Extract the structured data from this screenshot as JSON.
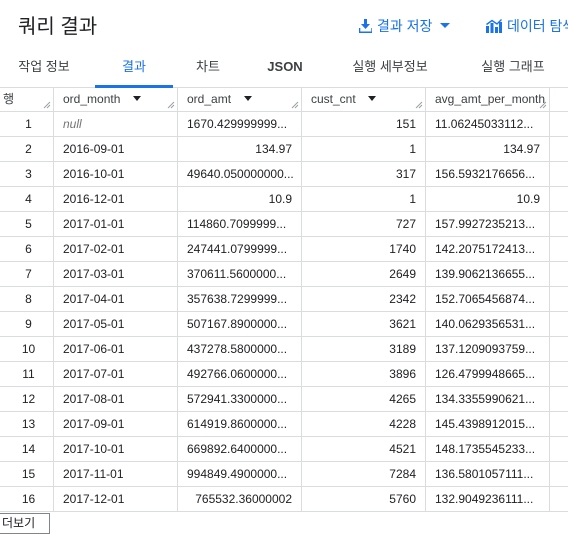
{
  "header": {
    "title": "쿼리 결과",
    "save_label": "결과 저장",
    "explore_label": "데이터 탐색"
  },
  "tabs": [
    {
      "label": "작업 정보"
    },
    {
      "label": "결과"
    },
    {
      "label": "차트"
    },
    {
      "label": "JSON"
    },
    {
      "label": "실행 세부정보"
    },
    {
      "label": "실행 그래프"
    }
  ],
  "table": {
    "columns": [
      "행",
      "ord_month",
      "ord_amt",
      "cust_cnt",
      "avg_amt_per_month"
    ],
    "rows": [
      {
        "idx": "1",
        "ord_month": "null",
        "ord_amt": "1670.429999999...",
        "cust_cnt": "151",
        "avg": "11.06245033112..."
      },
      {
        "idx": "2",
        "ord_month": "2016-09-01",
        "ord_amt": "134.97",
        "cust_cnt": "1",
        "avg": "134.97"
      },
      {
        "idx": "3",
        "ord_month": "2016-10-01",
        "ord_amt": "49640.050000000...",
        "cust_cnt": "317",
        "avg": "156.5932176656..."
      },
      {
        "idx": "4",
        "ord_month": "2016-12-01",
        "ord_amt": "10.9",
        "cust_cnt": "1",
        "avg": "10.9"
      },
      {
        "idx": "5",
        "ord_month": "2017-01-01",
        "ord_amt": "114860.7099999...",
        "cust_cnt": "727",
        "avg": "157.9927235213..."
      },
      {
        "idx": "6",
        "ord_month": "2017-02-01",
        "ord_amt": "247441.0799999...",
        "cust_cnt": "1740",
        "avg": "142.2075172413..."
      },
      {
        "idx": "7",
        "ord_month": "2017-03-01",
        "ord_amt": "370611.5600000...",
        "cust_cnt": "2649",
        "avg": "139.9062136655..."
      },
      {
        "idx": "8",
        "ord_month": "2017-04-01",
        "ord_amt": "357638.7299999...",
        "cust_cnt": "2342",
        "avg": "152.7065456874..."
      },
      {
        "idx": "9",
        "ord_month": "2017-05-01",
        "ord_amt": "507167.8900000...",
        "cust_cnt": "3621",
        "avg": "140.0629356531..."
      },
      {
        "idx": "10",
        "ord_month": "2017-06-01",
        "ord_amt": "437278.5800000...",
        "cust_cnt": "3189",
        "avg": "137.1209093759..."
      },
      {
        "idx": "11",
        "ord_month": "2017-07-01",
        "ord_amt": "492766.0600000...",
        "cust_cnt": "3896",
        "avg": "126.4799948665..."
      },
      {
        "idx": "12",
        "ord_month": "2017-08-01",
        "ord_amt": "572941.3300000...",
        "cust_cnt": "4265",
        "avg": "134.3355990621..."
      },
      {
        "idx": "13",
        "ord_month": "2017-09-01",
        "ord_amt": "614919.8600000...",
        "cust_cnt": "4228",
        "avg": "145.4398912015..."
      },
      {
        "idx": "14",
        "ord_month": "2017-10-01",
        "ord_amt": "669892.6400000...",
        "cust_cnt": "4521",
        "avg": "148.1735545233..."
      },
      {
        "idx": "15",
        "ord_month": "2017-11-01",
        "ord_amt": "994849.4900000...",
        "cust_cnt": "7284",
        "avg": "136.5801057111..."
      },
      {
        "idx": "16",
        "ord_month": "2017-12-01",
        "ord_amt": "765532.36000002",
        "cust_cnt": "5760",
        "avg": "132.9049236111..."
      }
    ]
  },
  "footer": {
    "more_label": "더보기"
  },
  "colors": {
    "accent": "#1a73e8",
    "border": "#dadce0",
    "text": "#202124"
  },
  "icons": {
    "save": "download-icon",
    "explore": "bar-chart-icon",
    "sort": "caret-down-icon",
    "resize": "resize-grip-icon"
  }
}
